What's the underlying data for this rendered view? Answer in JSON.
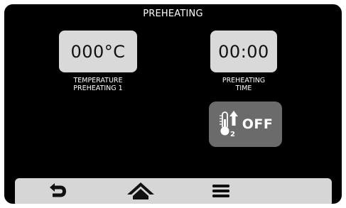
{
  "screen": {
    "title": "PREHEATING"
  },
  "temperature": {
    "value": "000°C",
    "caption_line1": "TEMPERATURE",
    "caption_line2": "PREHEATING 1"
  },
  "time": {
    "value": "00:00",
    "caption_line1": "PREHEATING",
    "caption_line2": "TIME"
  },
  "probe": {
    "icon": "thermometer-2-up-icon",
    "label": "OFF"
  },
  "bottom_bar": {
    "icons": [
      "back-arrow-icon",
      "home-icon",
      "menu-icon"
    ]
  },
  "colors": {
    "background": "#000000",
    "tile": "#d9d9d9",
    "tile_disabled": "#6b6b6b",
    "bar": "#d6d6d6",
    "text": "#ffffff"
  }
}
